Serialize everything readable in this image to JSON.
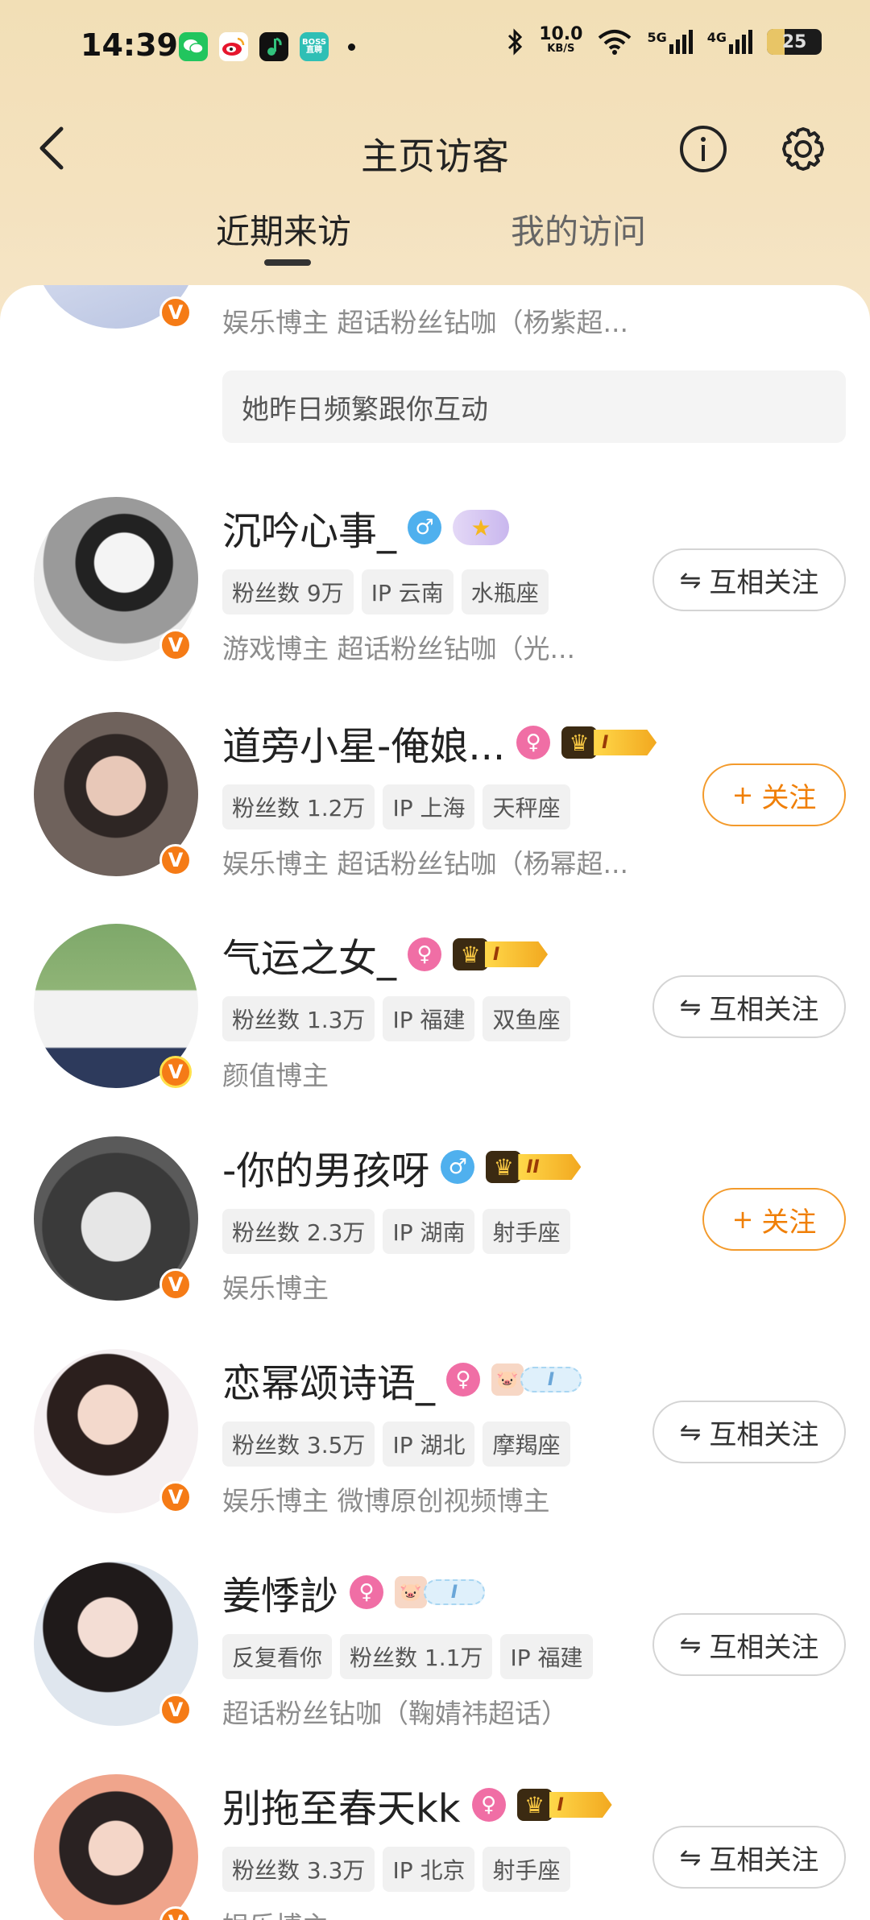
{
  "status": {
    "time": "14:39",
    "net_speed": "10.0",
    "net_unit": "KB/S",
    "signal1": "5G",
    "signal2": "4G",
    "battery": "25",
    "apps": [
      "wechat-icon",
      "weibo-icon",
      "qq-music-icon",
      "boss-zhipin-icon"
    ],
    "boss_label": "BOSS直聘"
  },
  "header": {
    "title": "主页访客"
  },
  "tabs": [
    {
      "label": "近期来访"
    },
    {
      "label": "我的访问"
    }
  ],
  "partial_row": {
    "desc": "娱乐博主 超话粉丝钻咖（杨紫超...",
    "hint": "她昨日频繁跟你互动"
  },
  "users": [
    {
      "name": "沉吟心事_",
      "gender": "♂",
      "chips": [
        "粉丝数 9万",
        "IP 云南",
        "水瓶座"
      ],
      "desc": "游戏博主 超话粉丝钻咖（光...",
      "button": "互相关注"
    },
    {
      "name": "道旁小星-俺娘...",
      "gender": "♀",
      "crown_level": "I",
      "chips": [
        "粉丝数 1.2万",
        "IP 上海",
        "天秤座"
      ],
      "desc": "娱乐博主 超话粉丝钻咖（杨幂超...",
      "button": "关注"
    },
    {
      "name": "气运之女_",
      "gender": "♀",
      "crown_level": "I",
      "chips": [
        "粉丝数 1.3万",
        "IP 福建",
        "双鱼座"
      ],
      "desc": "颜值博主",
      "button": "互相关注"
    },
    {
      "name": "-你的男孩呀",
      "gender": "♂",
      "crown_level": "II",
      "chips": [
        "粉丝数 2.3万",
        "IP 湖南",
        "射手座"
      ],
      "desc": "娱乐博主",
      "button": "关注"
    },
    {
      "name": "恋幂颂诗语_",
      "gender": "♀",
      "pet_level": "I",
      "chips": [
        "粉丝数 3.5万",
        "IP 湖北",
        "摩羯座"
      ],
      "desc": "娱乐博主 微博原创视频博主",
      "button": "互相关注"
    },
    {
      "name": "姜悸訬",
      "gender": "♀",
      "pet_level": "I",
      "chips": [
        "反复看你",
        "粉丝数 1.1万",
        "IP 福建"
      ],
      "desc": "超话粉丝钻咖（鞠婧祎超话）",
      "button": "互相关注"
    },
    {
      "name": "别拖至春天kk",
      "gender": "♀",
      "crown_level": "I",
      "chips": [
        "粉丝数 3.3万",
        "IP 北京",
        "射手座"
      ],
      "desc": "娱乐博主",
      "button": "互相关注"
    }
  ],
  "icons": {
    "mutual": "⇋",
    "add": "+"
  }
}
